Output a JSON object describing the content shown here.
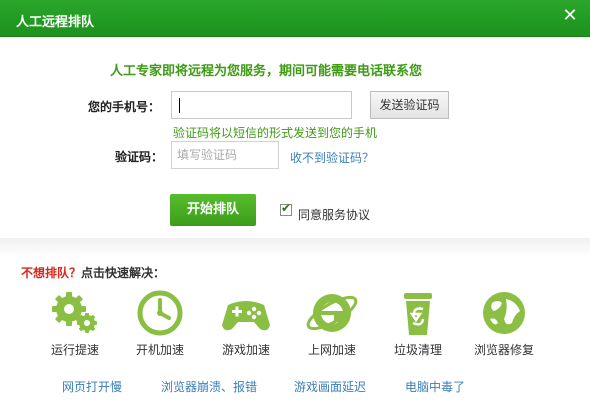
{
  "window": {
    "title": "人工远程排队"
  },
  "colors": {
    "accent": "#3d9c1a",
    "titlebar": "#1d921d",
    "warning": "#d8281b",
    "link": "#3a7fb8"
  },
  "form": {
    "headline": "人工专家即将远程为您服务，期间可能需要电话联系您",
    "phone_label": "您的手机号：",
    "phone_value": "",
    "send_code_label": "发送验证码",
    "hint": "验证码将以短信的形式发送到您的手机",
    "code_label": "验证码：",
    "code_placeholder": "填写验证码",
    "no_code_link": "收不到验证码？",
    "start_label": "开始排队",
    "agree_checked": true,
    "agree_label": "同意服务协议"
  },
  "quick": {
    "title_red": "不想排队？",
    "title_rest": "点击快速解决：",
    "tools": [
      {
        "label": "运行提速",
        "icon": "gears-icon"
      },
      {
        "label": "开机加速",
        "icon": "clock-icon"
      },
      {
        "label": "游戏加速",
        "icon": "gamepad-icon"
      },
      {
        "label": "上网加速",
        "icon": "browser-e-icon"
      },
      {
        "label": "垃圾清理",
        "icon": "trash-icon"
      },
      {
        "label": "浏览器修复",
        "icon": "globe-icon"
      }
    ],
    "links": [
      "网页打开慢",
      "浏览器崩溃、报错",
      "游戏画面延迟",
      "电脑中毒了"
    ]
  }
}
